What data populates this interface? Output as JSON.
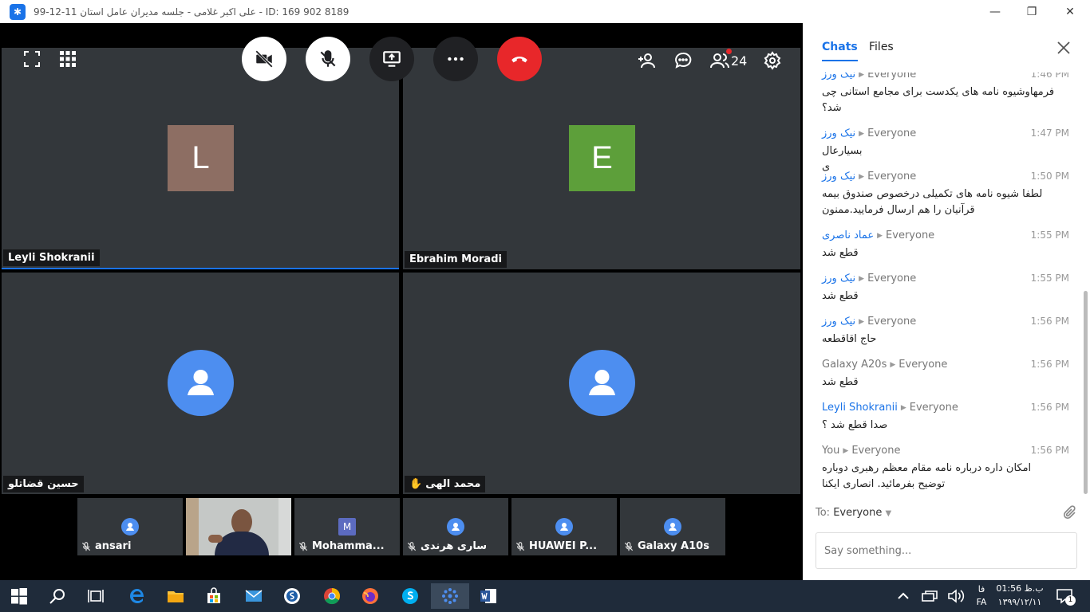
{
  "titlebar": {
    "title": "99-12-11 علی اکبر غلامی - جلسه مدیران عامل استان - ID: 169 902 8189"
  },
  "controls": {
    "fullscreen": "fullscreen-icon",
    "grid": "grid-icon",
    "participants_count": "24",
    "colors": {
      "end_call": "#e8272a",
      "active_white": "#ffffff",
      "dark": "#202124"
    }
  },
  "tiles": [
    {
      "name": "Leyli Shokranii",
      "letter": "L",
      "color": "#8d6e63"
    },
    {
      "name": "Ebrahim Moradi",
      "letter": "E",
      "color": "#5d9f3a"
    },
    {
      "name": "حسین قضاتلو"
    },
    {
      "name": "محمد الهی"
    }
  ],
  "thumbs": [
    {
      "name": "ansari"
    },
    {
      "name": ""
    },
    {
      "name": "Mohamma...",
      "letter": "M"
    },
    {
      "name": "ساری هرندی"
    },
    {
      "name": "HUAWEI P..."
    },
    {
      "name": "Galaxy A10s"
    }
  ],
  "chat": {
    "tabs": [
      "Chats",
      "Files"
    ],
    "messages": [
      {
        "author": "نیک ورز",
        "to": "Everyone",
        "time": "1:46 PM",
        "text": "فرمهاوشیوه نامه های یکدست برای مجامع استانی چی\nشد؟"
      },
      {
        "author": "نیک ورز",
        "to": "Everyone",
        "time": "1:47 PM",
        "text": "بسیارعال\nی"
      },
      {
        "author": "نیک ورز",
        "to": "Everyone",
        "time": "1:50 PM",
        "text": "لطفا شیوه نامه های تکمیلی درخصوص صندوق بیمه\nقرآنیان را هم ارسال فرمایید.ممنون"
      },
      {
        "author": "عماد ناصری",
        "to": "Everyone",
        "time": "1:55 PM",
        "text": "قطع شد"
      },
      {
        "author": "نیک ورز",
        "to": "Everyone",
        "time": "1:55 PM",
        "text": "قطع شد"
      },
      {
        "author": "نیک ورز",
        "to": "Everyone",
        "time": "1:56 PM",
        "text": "حاج اقاقطعه"
      },
      {
        "author": "Galaxy A20s",
        "to": "Everyone",
        "time": "1:56 PM",
        "text": "قطع شد"
      },
      {
        "author": "Leyli Shokranii",
        "to": "Everyone",
        "time": "1:56 PM",
        "text": "صدا قطع شد ؟"
      },
      {
        "author": "You",
        "to": "Everyone",
        "time": "1:56 PM",
        "text": "امکان داره درباره نامه مقام معظم رهبری دوباره\nتوضیح بفرمائید. انصاری ایکنا"
      }
    ],
    "to_label": "To:",
    "to_value": "Everyone",
    "placeholder": "Say something..."
  },
  "taskbar": {
    "lang_top": "فا",
    "lang_bottom": "FA",
    "time": "01:56 ب.ظ",
    "date": "۱۳۹۹/۱۲/۱۱",
    "notif_count": "1"
  }
}
